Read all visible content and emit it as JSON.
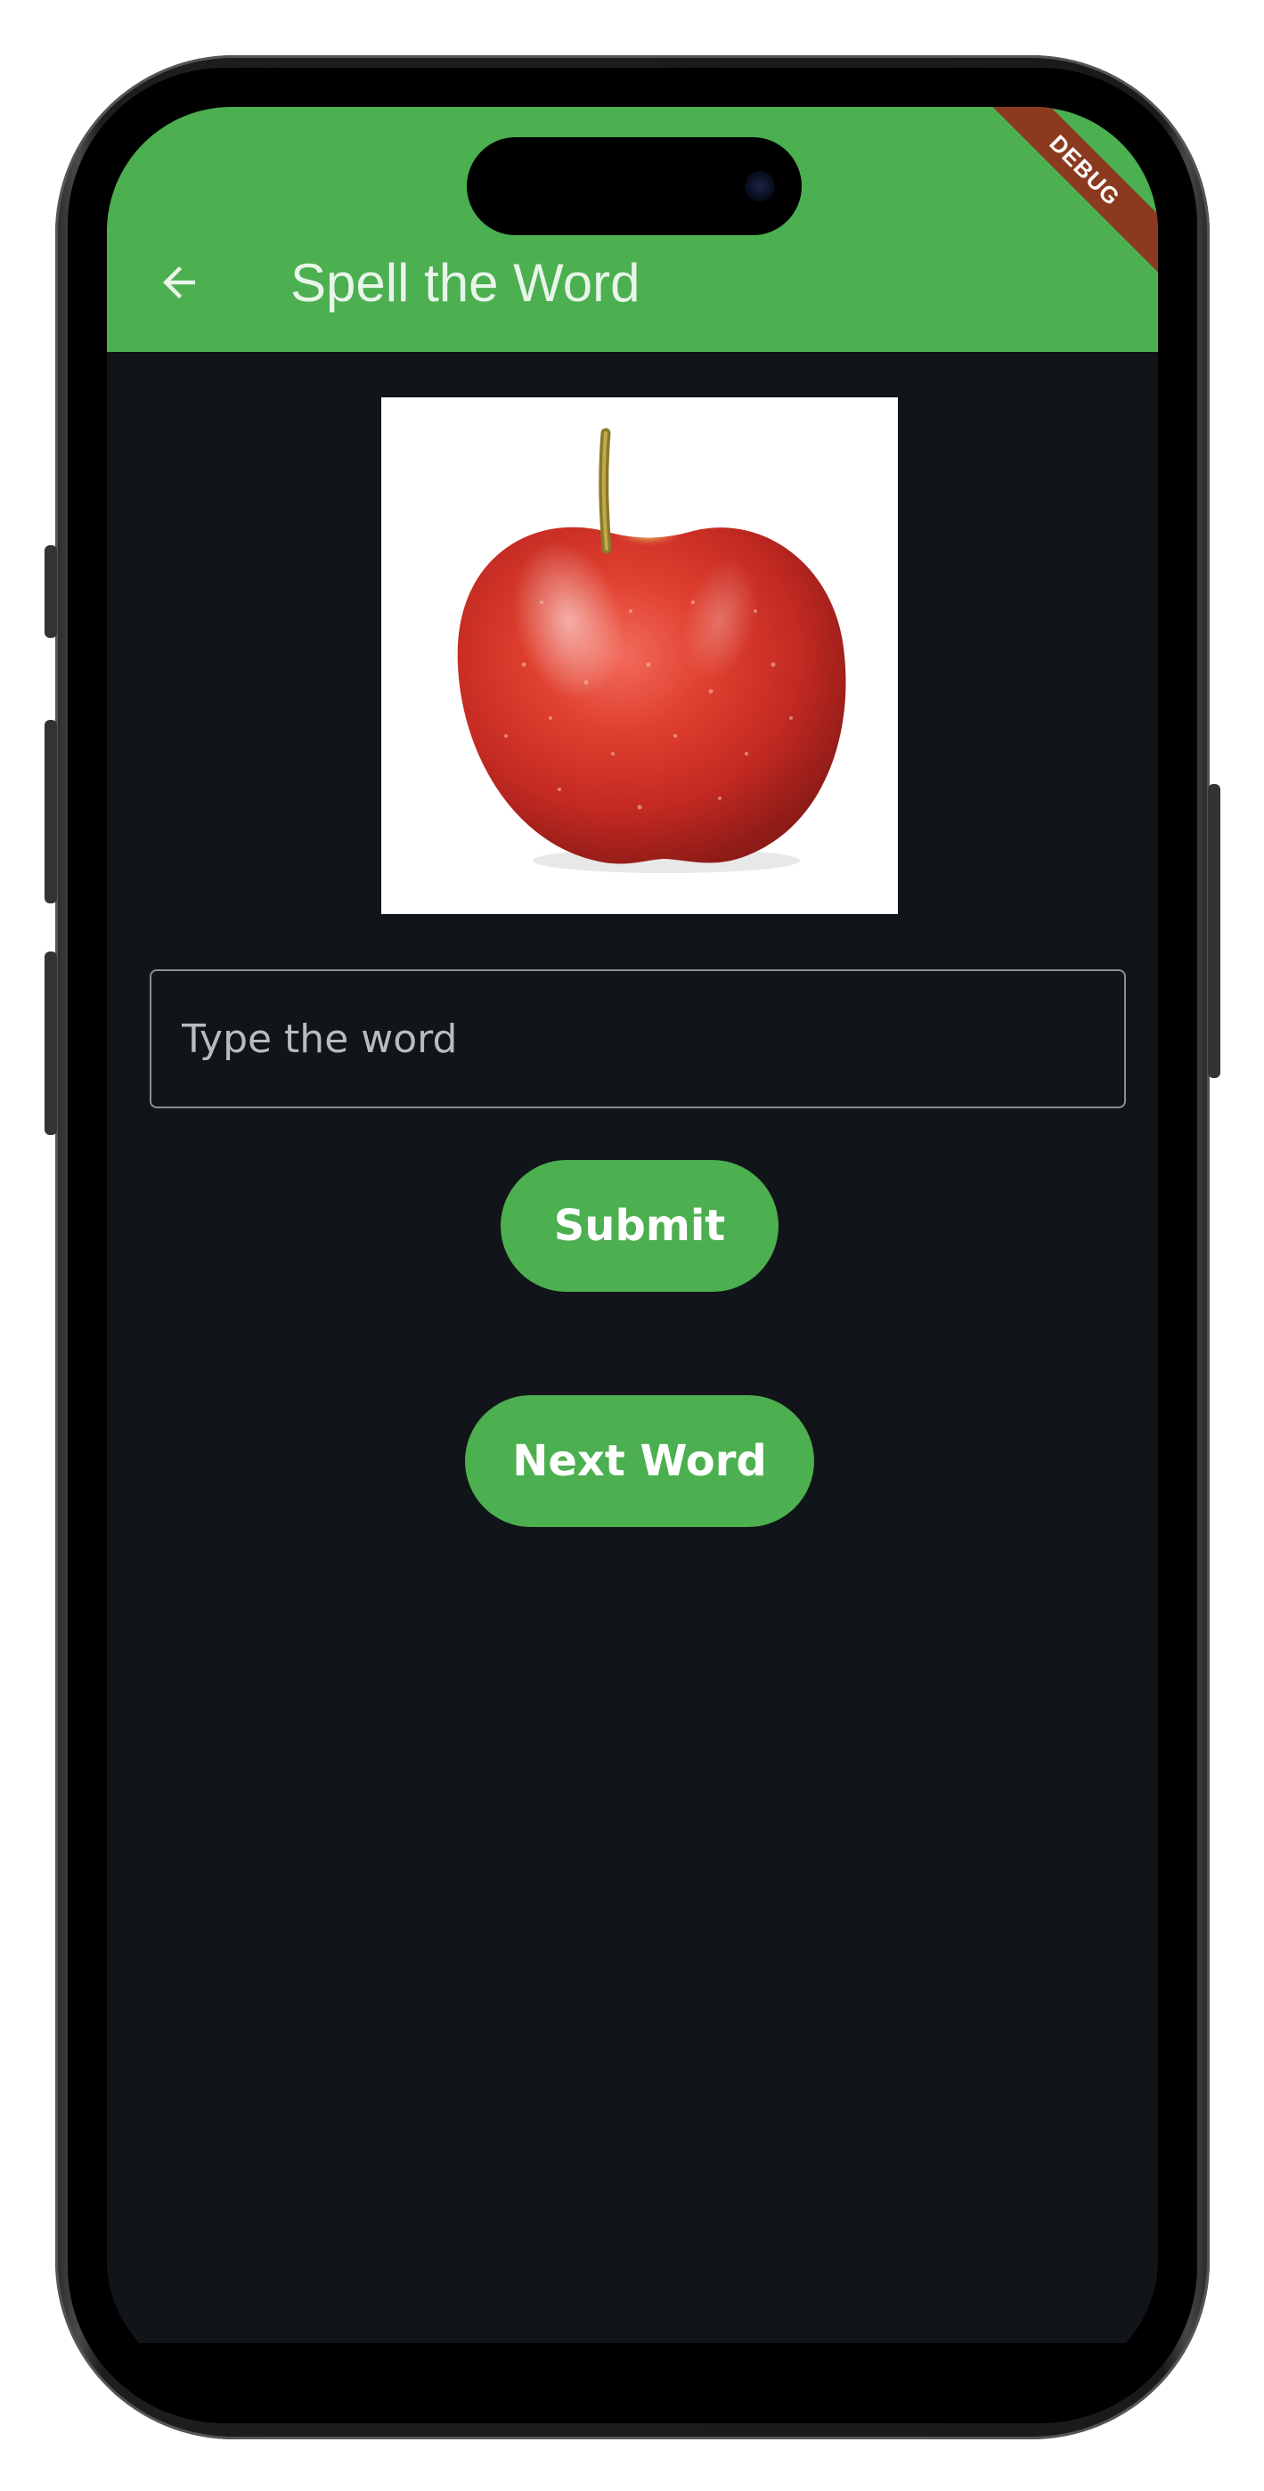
{
  "app_bar": {
    "title": "Spell the Word",
    "back_icon": "arrow-left-icon",
    "color": "#4caf50"
  },
  "debug_banner": {
    "label": "DEBUG"
  },
  "word_image": {
    "subject": "apple",
    "icon": "apple-image"
  },
  "input": {
    "placeholder": "Type the word",
    "value": ""
  },
  "buttons": {
    "submit_label": "Submit",
    "next_label": "Next Word"
  },
  "colors": {
    "accent": "#4caf50",
    "background": "#111418",
    "debug_banner": "#8b3a1f"
  }
}
